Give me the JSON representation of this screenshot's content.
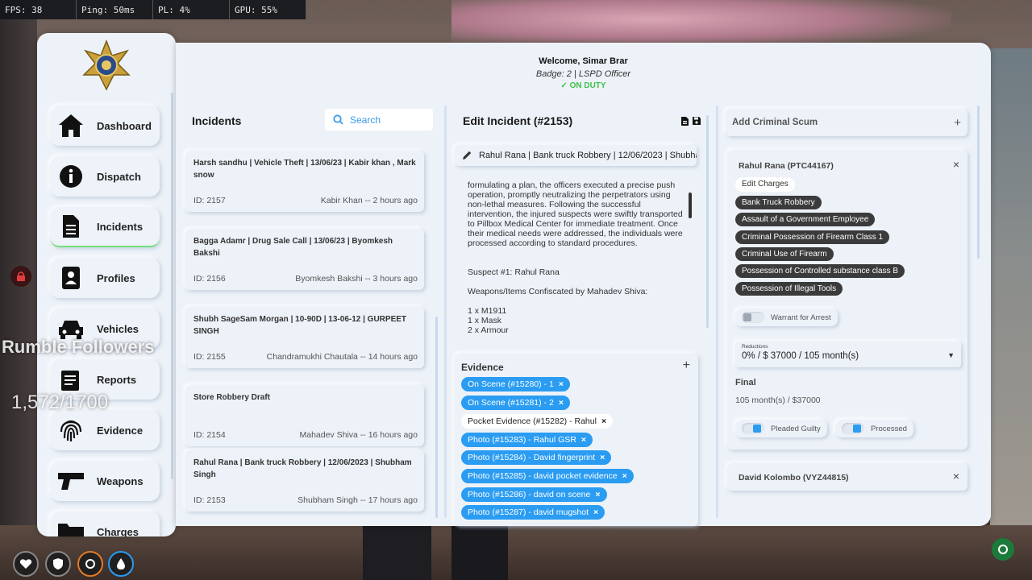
{
  "debug": {
    "fps": "FPS: 38",
    "ping": "Ping: 50ms",
    "pl": "PL: 4%",
    "gpu": "GPU: 55%"
  },
  "sidebar": {
    "items": [
      {
        "label": "Dashboard",
        "icon": "home-icon"
      },
      {
        "label": "Dispatch",
        "icon": "info-icon"
      },
      {
        "label": "Incidents",
        "icon": "document-icon",
        "active": true
      },
      {
        "label": "Profiles",
        "icon": "profile-icon"
      },
      {
        "label": "Vehicles",
        "icon": "car-icon"
      },
      {
        "label": "Reports",
        "icon": "reports-icon"
      },
      {
        "label": "Evidence",
        "icon": "fingerprint-icon"
      },
      {
        "label": "Weapons",
        "icon": "gun-icon"
      },
      {
        "label": "Charges",
        "icon": "folder-icon"
      }
    ]
  },
  "header": {
    "welcome": "Welcome, Simar Brar",
    "badge": "Badge: 2 | LSPD Officer",
    "duty": "✓ ON DUTY"
  },
  "incidents": {
    "title": "Incidents",
    "search_placeholder": "Search",
    "items": [
      {
        "title": "Harsh sandhu | Vehicle Theft | 13/06/23 | Kabir khan , Mark snow",
        "id": "ID: 2157",
        "meta": "Kabir Khan -- 2 hours ago"
      },
      {
        "title": "Bagga Adamr | Drug Sale Call | 13/06/23 | Byomkesh Bakshi",
        "id": "ID: 2156",
        "meta": "Byomkesh Bakshi -- 3 hours ago"
      },
      {
        "title": "Shubh SageSam Morgan | 10-90D | 13-06-12 | GURPEET SINGH",
        "id": "ID: 2155",
        "meta": "Chandramukhi Chautala -- 14 hours ago"
      },
      {
        "title": "Store Robbery Draft",
        "id": "ID: 2154",
        "meta": "Mahadev Shiva -- 16 hours ago"
      },
      {
        "title": "Rahul Rana | Bank truck Robbery | 12/06/2023 | Shubham Singh",
        "id": "ID: 2153",
        "meta": "Shubham Singh -- 17 hours ago"
      }
    ]
  },
  "edit": {
    "title": "Edit Incident (#2153)",
    "incident_title": "Rahul Rana | Bank truck Robbery  | 12/06/2023 | Shubham Singh",
    "report_lines": [
      "formulating a plan, the officers executed a precise push",
      "operation, promptly neutralizing the perpetrators using",
      "non-lethal measures. Following the successful",
      "intervention, the injured suspects were swiftly transported",
      "to Pillbox Medical Center for immediate treatment. Once",
      "their medical needs were addressed, the individuals were",
      "processed according to standard procedures."
    ],
    "suspect": "Suspect #1: Rahul Rana",
    "weapons_header": "Weapons/Items Confiscated by Mahadev Shiva:",
    "weapons": [
      "1 x M1911",
      "1 x Mask",
      "2 x Armour"
    ],
    "evidence_title": "Evidence",
    "evidence": [
      {
        "label": "On Scene (#15280) - 1",
        "style": "blue"
      },
      {
        "label": "On Scene (#15281) - 2",
        "style": "blue"
      },
      {
        "label": "Pocket Evidence (#15282) - Rahul",
        "style": "plain"
      },
      {
        "label": "Photo (#15283) - Rahul GSR",
        "style": "blue"
      },
      {
        "label": "Photo (#15284) - David fingerprint",
        "style": "blue"
      },
      {
        "label": "Photo (#15285) - david pocket evidence",
        "style": "blue"
      },
      {
        "label": "Photo (#15286) - david on scene",
        "style": "blue"
      },
      {
        "label": "Photo (#15287) - david mugshot",
        "style": "blue"
      }
    ]
  },
  "criminals": {
    "add_label": "Add Criminal Scum",
    "list": [
      {
        "name": "Rahul Rana (PTC44167)",
        "edit_charges": "Edit Charges",
        "charges": [
          "Bank Truck Robbery",
          "Assault of a Government Employee",
          "Criminal Possession of Firearm Class 1",
          "Criminal Use of Firearm",
          "Possession of Controlled substance class B",
          "Possession of Illegal Tools"
        ],
        "warrant_label": "Warrant for Arrest",
        "reductions_label": "Reductions",
        "reductions_value": "0% / $ 37000 / 105 month(s)",
        "final_label": "Final",
        "final_value": "105 month(s) / $37000",
        "pleaded_label": "Pleaded Guilty",
        "processed_label": "Processed"
      },
      {
        "name": "David Kolombo (VYZ44815)"
      }
    ]
  },
  "overlay": {
    "rumble": "Rumble Followers",
    "count": "1,572/1700"
  },
  "colors": {
    "accent": "#2a9cf2",
    "on_duty": "#3cc24a",
    "panel": "#edf2f8"
  }
}
